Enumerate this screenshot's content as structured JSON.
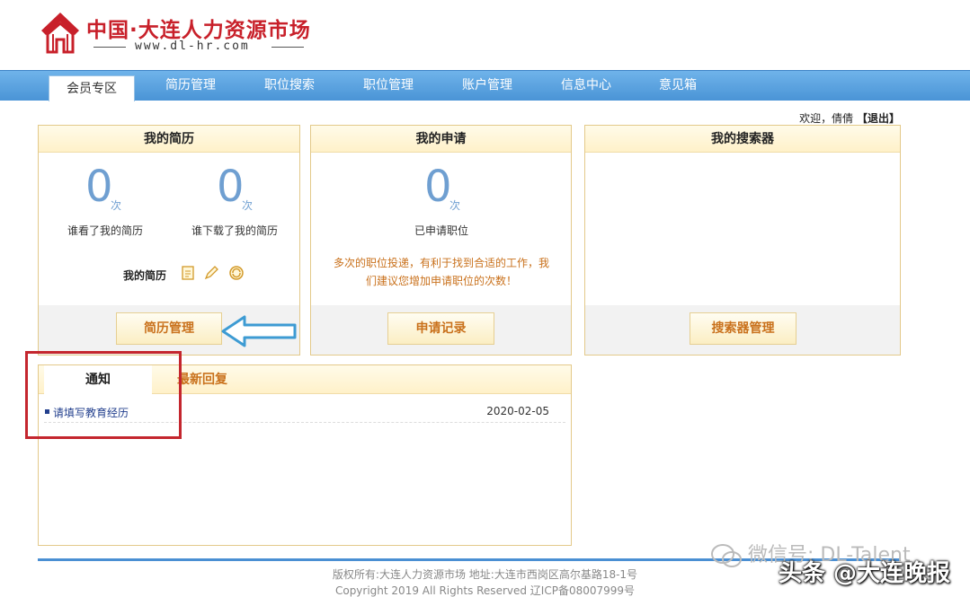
{
  "header": {
    "title": "中国·大连人力资源市场",
    "url": "www.dl-hr.com"
  },
  "nav": {
    "items": [
      "会员专区",
      "简历管理",
      "职位搜索",
      "职位管理",
      "账户管理",
      "信息中心",
      "意见箱"
    ]
  },
  "welcome": {
    "text": "欢迎，倩倩",
    "logout": "【退出】"
  },
  "my_resume": {
    "title": "我的简历",
    "views_count": "0",
    "views_unit": "次",
    "views_label": "谁看了我的简历",
    "downloads_count": "0",
    "downloads_unit": "次",
    "downloads_label": "谁下载了我的简历",
    "resume_label": "我的简历",
    "manage_button": "简历管理"
  },
  "my_applications": {
    "title": "我的申请",
    "count": "0",
    "unit": "次",
    "label": "已申请职位",
    "tip_line1": "多次的职位投递，有利于找到合适的工作，我",
    "tip_line2": "们建议您增加申请职位的次数！",
    "records_button": "申请记录"
  },
  "my_searchers": {
    "title": "我的搜索器",
    "manage_button": "搜索器管理"
  },
  "notices": {
    "tabs": [
      "通知",
      "最新回复"
    ],
    "items": [
      {
        "title": "请填写教育经历",
        "date": "2020-02-05"
      }
    ]
  },
  "footer": {
    "line1": "版权所有:大连人力资源市场   地址:大连市西岗区高尔基路18-1号",
    "line2": "Copyright 2019 All Rights Reserved   辽ICP备08007999号"
  },
  "watermark": {
    "wechat": "微信号: DL-Talent",
    "toutiao": "头条 @大连晚报"
  },
  "colors": {
    "brand_red": "#c8202a",
    "nav_blue": "#4a94d6",
    "accent_orange": "#c9711c",
    "count_blue": "#6f9fd1",
    "annotation_red": "#c4262e",
    "annotation_arrow": "#3d9bd3"
  }
}
